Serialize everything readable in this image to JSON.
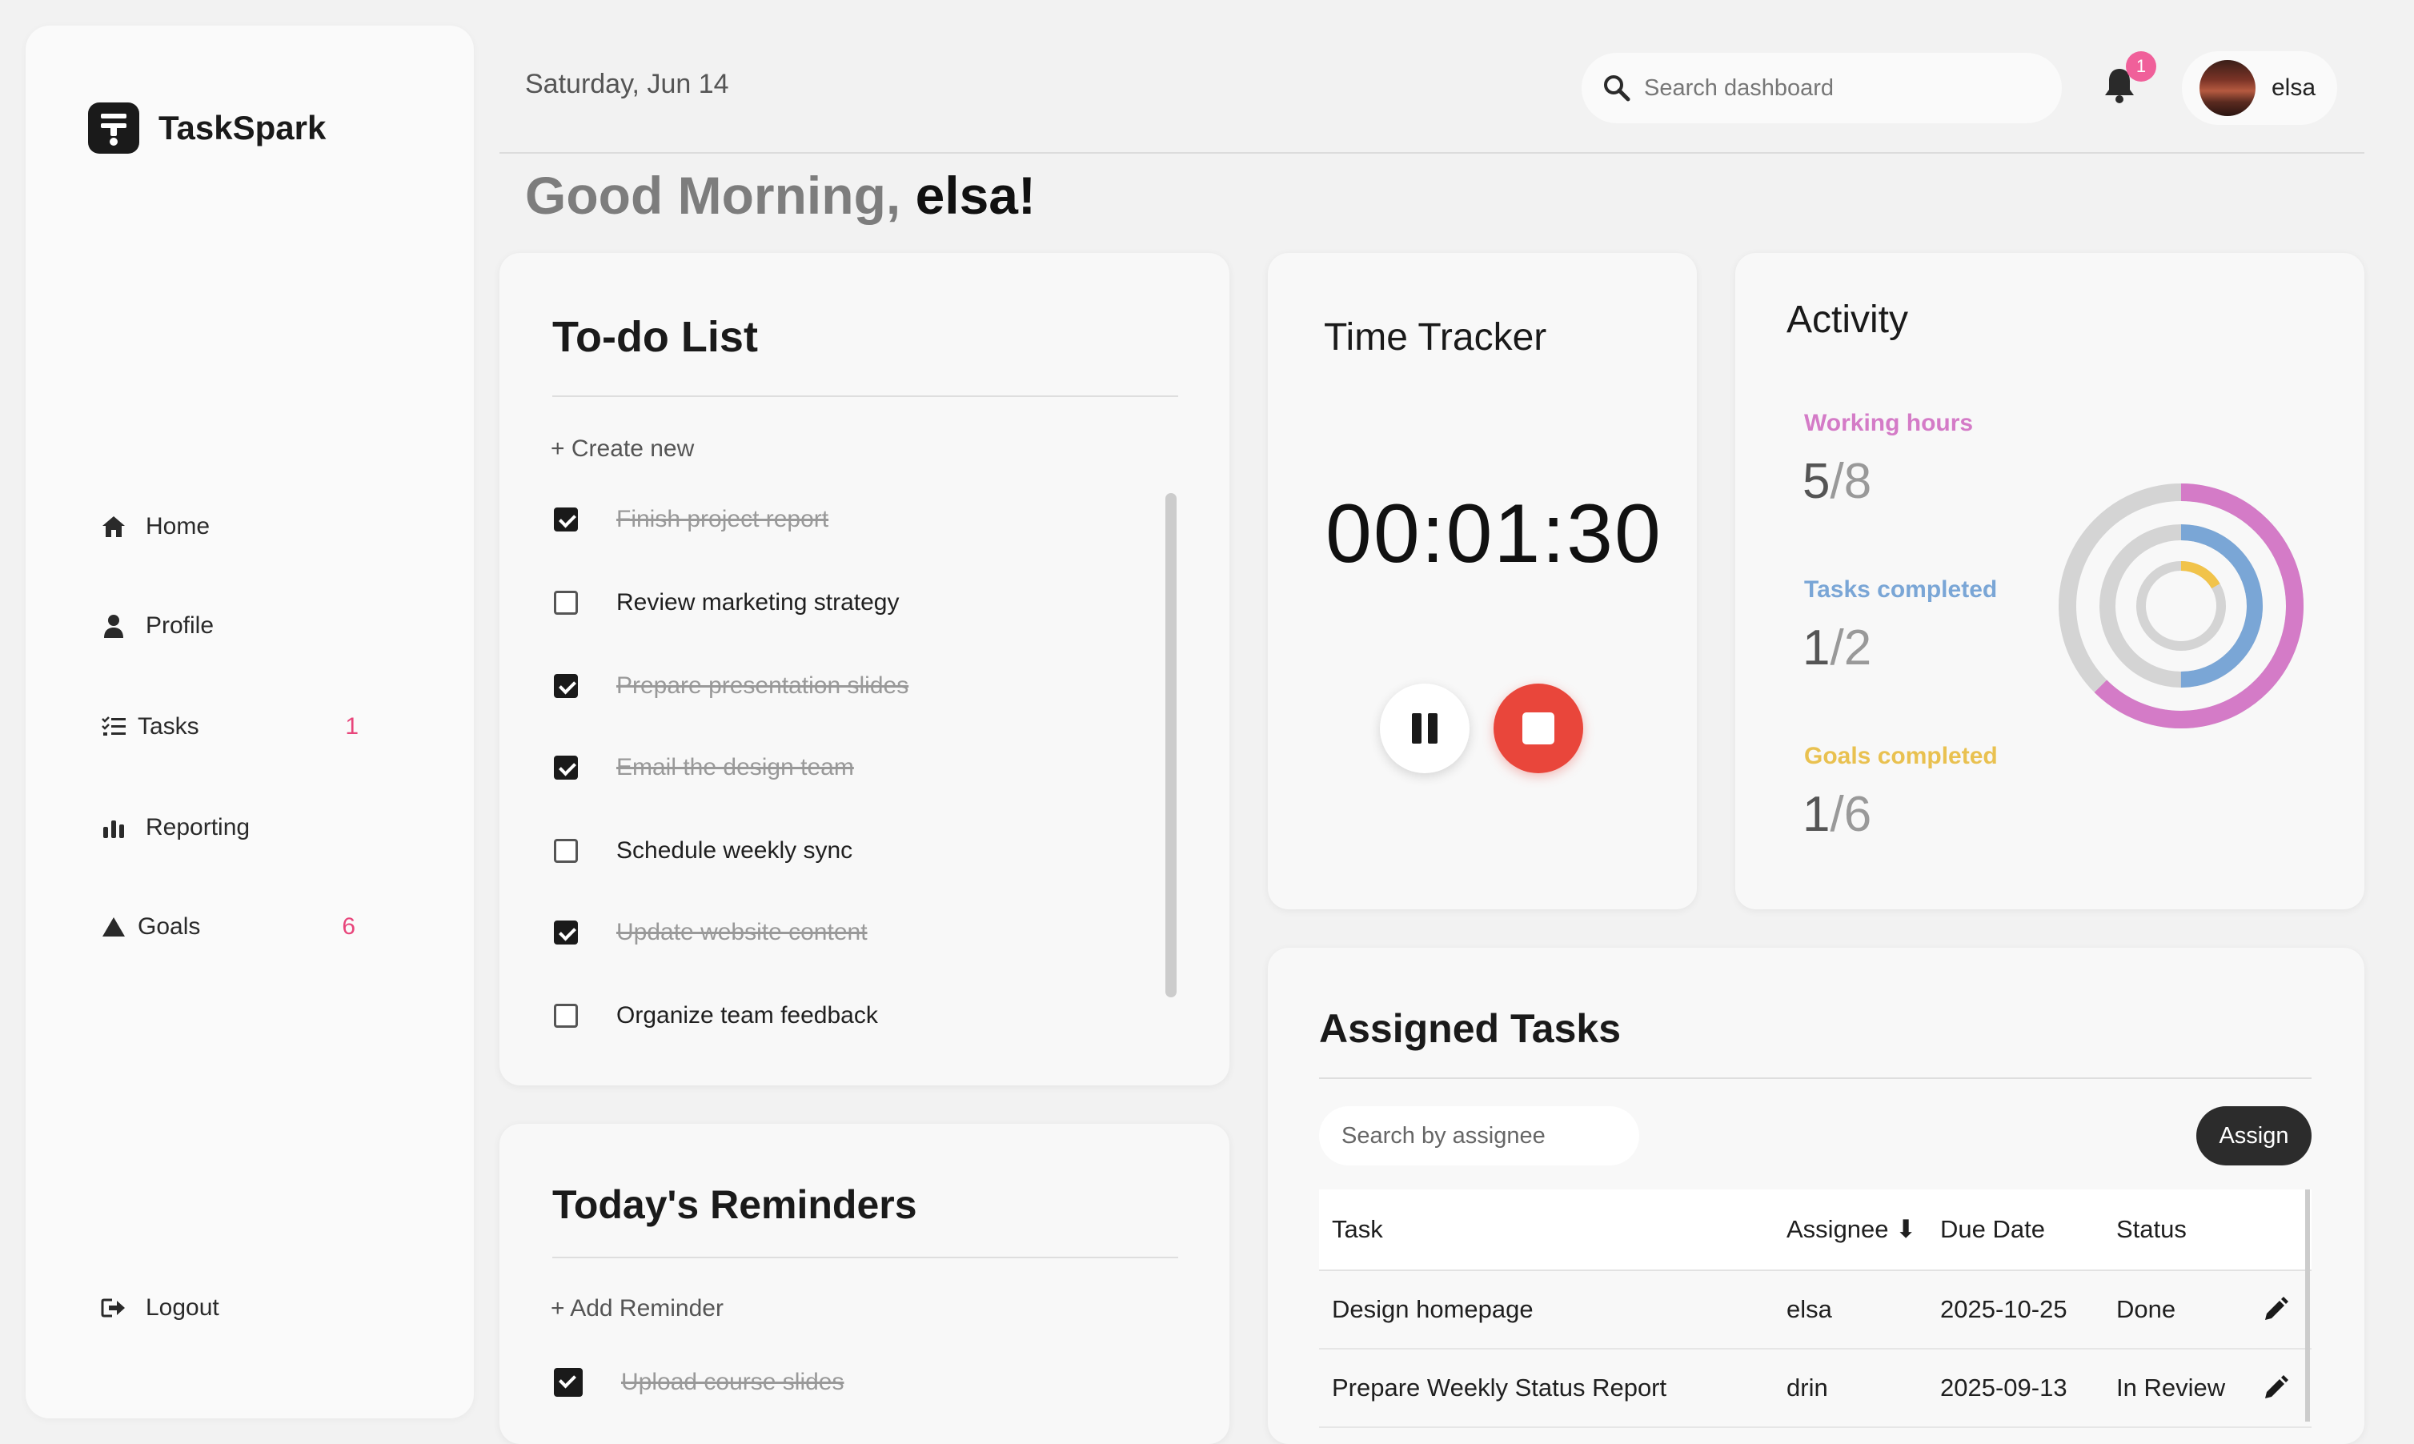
{
  "app": {
    "name": "TaskSpark",
    "date": "Saturday, Jun 14",
    "search_placeholder": "Search dashboard",
    "notification_count": "1",
    "user": "elsa"
  },
  "greeting": {
    "prefix": "Good Morning, ",
    "name": "elsa!"
  },
  "sidebar": {
    "items": [
      {
        "label": "Home",
        "icon": "home-icon",
        "badge": ""
      },
      {
        "label": "Profile",
        "icon": "user-icon",
        "badge": ""
      },
      {
        "label": "Tasks",
        "icon": "list-icon",
        "badge": "1"
      },
      {
        "label": "Reporting",
        "icon": "bar-chart-icon",
        "badge": ""
      },
      {
        "label": "Goals",
        "icon": "triangle-icon",
        "badge": "6"
      }
    ],
    "logout": "Logout"
  },
  "todo": {
    "title": "To-do List",
    "create": "+ Create new",
    "items": [
      {
        "text": "Finish project report",
        "done": true
      },
      {
        "text": "Review marketing strategy",
        "done": false
      },
      {
        "text": "Prepare presentation slides",
        "done": true
      },
      {
        "text": "Email the design team",
        "done": true
      },
      {
        "text": "Schedule weekly sync",
        "done": false
      },
      {
        "text": "Update website content",
        "done": true
      },
      {
        "text": "Organize team feedback",
        "done": false
      }
    ]
  },
  "reminders": {
    "title": "Today's Reminders",
    "add": "+ Add Reminder",
    "items": [
      {
        "text": "Upload course slides",
        "done": true
      }
    ]
  },
  "time_tracker": {
    "title": "Time Tracker",
    "time": "00:01:30"
  },
  "activity": {
    "title": "Activity",
    "metrics": [
      {
        "label": "Working hours",
        "value": "5",
        "total": "/8",
        "fraction": 0.625,
        "color": "#d47bc7"
      },
      {
        "label": "Tasks completed",
        "value": "1",
        "total": "/2",
        "fraction": 0.5,
        "color": "#7aa6d6"
      },
      {
        "label": "Goals completed",
        "value": "1",
        "total": "/6",
        "fraction": 0.1667,
        "color": "#f1c34a"
      }
    ]
  },
  "assigned": {
    "title": "Assigned Tasks",
    "search_placeholder": "Search by assignee",
    "assign_label": "Assign",
    "columns": [
      "Task",
      "Assignee ⬇",
      "Due Date",
      "Status"
    ],
    "rows": [
      [
        "Design homepage",
        "elsa",
        "2025-10-25",
        "Done"
      ],
      [
        "Prepare Weekly Status Report",
        "drin",
        "2025-09-13",
        "In Review"
      ]
    ]
  }
}
